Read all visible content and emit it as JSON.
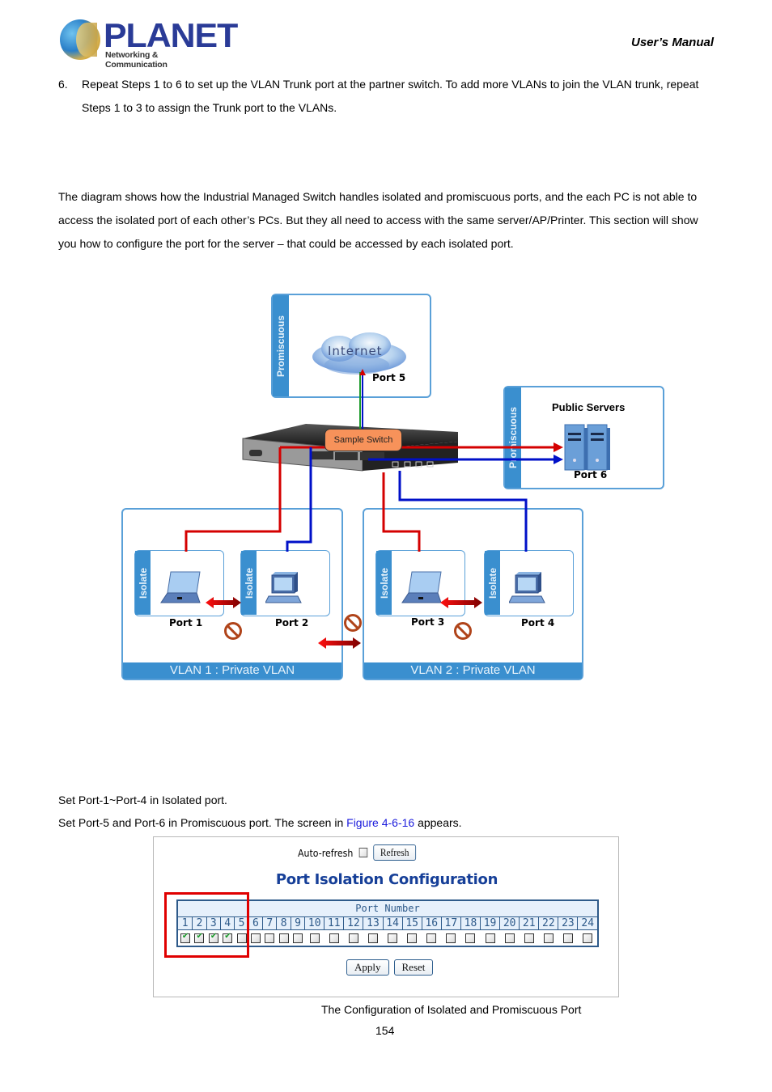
{
  "header": {
    "brand": "PLANET",
    "tagline": "Networking & Communication",
    "doc_title": "User’s  Manual"
  },
  "step6": {
    "number": "6.",
    "text": "Repeat Steps 1 to 6 to set up the VLAN Trunk port at the partner switch. To add more VLANs to join the VLAN trunk, repeat Steps 1 to 3 to assign the Trunk port to the VLANs."
  },
  "intro": "The diagram shows how the Industrial Managed Switch handles isolated and promiscuous ports, and the each PC is not able to access the isolated port of each other’s PCs. But they all need to access with the same server/AP/Printer. This section will show you how to configure the port for the server – that could be accessed by each isolated port.",
  "diagram": {
    "internet_box": {
      "side_label": "Promiscuous",
      "cloud_label": "Internet",
      "port_label": "Port 5"
    },
    "server_box": {
      "side_label": "Promiscuous",
      "title": "Public Servers",
      "port_label": "Port 6"
    },
    "switch_label": "Sample Switch",
    "vlan1": {
      "label": "VLAN 1 : Private VLAN",
      "hosts": [
        {
          "side_label": "Isolate",
          "device": "laptop",
          "port_label": "Port 1"
        },
        {
          "side_label": "Isolate",
          "device": "desktop",
          "port_label": "Port 2"
        }
      ]
    },
    "vlan2": {
      "label": "VLAN 2 : Private VLAN",
      "hosts": [
        {
          "side_label": "Isolate",
          "device": "laptop",
          "port_label": "Port 3"
        },
        {
          "side_label": "Isolate",
          "device": "desktop",
          "port_label": "Port 4"
        }
      ]
    },
    "colors": {
      "frame": "#5aa0d8",
      "side": "#3a8fcf",
      "red_link": "#d40000",
      "blue_link": "#0010c8",
      "switch_label_bg": "#f7925a",
      "no_entry": "#b0441a"
    }
  },
  "instructions": {
    "line1": "Set Port-1~Port-4 in Isolated port.",
    "line2_before": "Set Port-5 and Port-6 in Promiscuous port. The screen in ",
    "line2_link": "Figure 4-6-16",
    "line2_after": " appears."
  },
  "panel": {
    "auto_refresh_label": "Auto-refresh",
    "auto_refresh_checked": false,
    "refresh_button": "Refresh",
    "title": "Port Isolation Configuration",
    "table_header": "Port Number",
    "ports": [
      "1",
      "2",
      "3",
      "4",
      "5",
      "6",
      "7",
      "8",
      "9",
      "10",
      "11",
      "12",
      "13",
      "14",
      "15",
      "16",
      "17",
      "18",
      "19",
      "20",
      "21",
      "22",
      "23",
      "24"
    ],
    "checked": [
      true,
      true,
      true,
      true,
      false,
      false,
      false,
      false,
      false,
      false,
      false,
      false,
      false,
      false,
      false,
      false,
      false,
      false,
      false,
      false,
      false,
      false,
      false,
      false
    ],
    "apply_button": "Apply",
    "reset_button": "Reset",
    "highlight_color": "#e00000",
    "title_color": "#163f98"
  },
  "caption": "The Configuration of Isolated and Promiscuous Port",
  "page_number": "154"
}
